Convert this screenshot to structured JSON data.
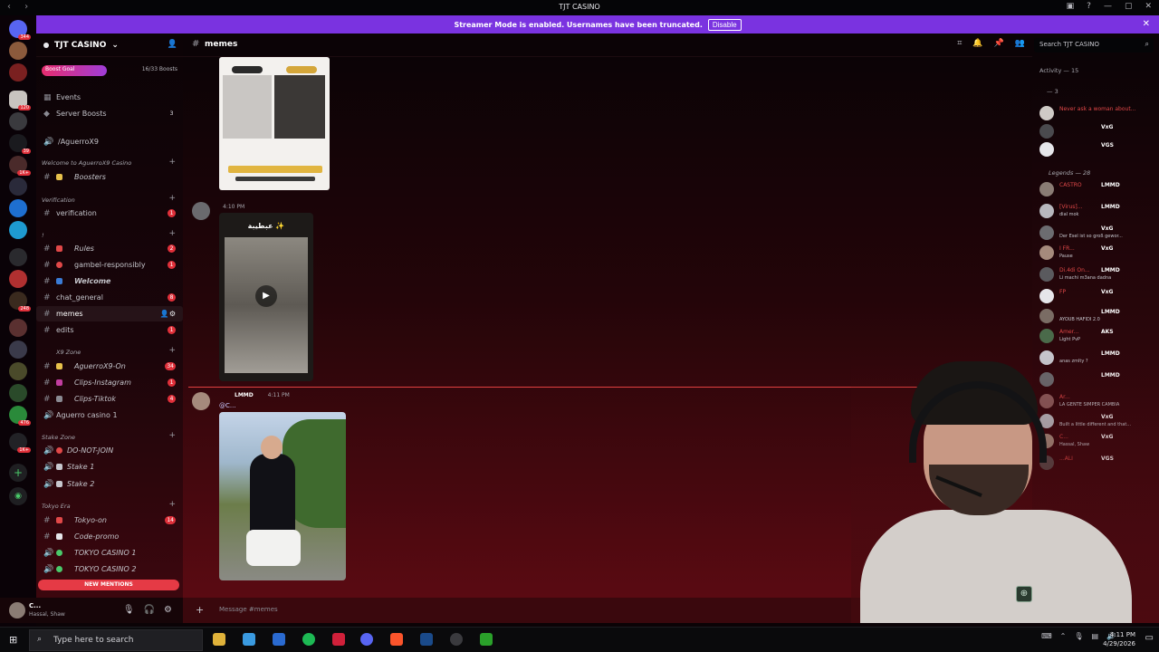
{
  "window": {
    "title": "TJT CASINO"
  },
  "banner": {
    "text": "Streamer Mode is enabled. Usernames have been truncated.",
    "button": "Disable"
  },
  "server": {
    "name": "TJT CASINO",
    "boost_goal": "Boost Goal",
    "boost_count": "16/33 Boosts",
    "boost_progress": 0.48
  },
  "guild_badges": [
    "344",
    "120",
    "39",
    "1K+",
    "248",
    "1K+",
    "476"
  ],
  "channels": [
    {
      "name": "Events",
      "kind": "events"
    },
    {
      "name": "Server Boosts",
      "kind": "boosts",
      "count": "3"
    },
    {
      "name": "/AguerroX9",
      "kind": "voice"
    },
    {
      "name": "Welcome to AguerroX9 Casino",
      "kind": "category"
    },
    {
      "name": "Boosters",
      "kind": "text",
      "emoji_color": "#e7c14b"
    },
    {
      "name": "Verification",
      "kind": "category"
    },
    {
      "name": "verification",
      "kind": "text",
      "count": "1"
    },
    {
      "name": "!",
      "kind": "category"
    },
    {
      "name": "Rules",
      "kind": "text",
      "count": "2",
      "emoji_color": "#e04848"
    },
    {
      "name": "gambel-responsibly",
      "kind": "text",
      "count": "1",
      "emoji_color": "#e04848"
    },
    {
      "name": "Welcome",
      "kind": "text",
      "emoji_color": "#3a7bd5"
    },
    {
      "name": "chat_general",
      "kind": "text",
      "count": "8"
    },
    {
      "name": "memes",
      "kind": "text",
      "active": true
    },
    {
      "name": "edits",
      "kind": "text",
      "count": "1"
    },
    {
      "name": "X9 Zone",
      "kind": "category"
    },
    {
      "name": "AguerroX9-On",
      "kind": "text",
      "count": "34",
      "emoji_color": "#e7c14b"
    },
    {
      "name": "Clips-Instagram",
      "kind": "text",
      "count": "1",
      "emoji_color": "#c23ea0"
    },
    {
      "name": "Clips-Tiktok",
      "kind": "text",
      "count": "4",
      "emoji_color": "#8a8a92"
    },
    {
      "name": "Aguerro casino 1",
      "kind": "voice"
    },
    {
      "name": "Stake Zone",
      "kind": "category"
    },
    {
      "name": "DO-NOT-JOIN",
      "kind": "text",
      "emoji_color": "#e04848"
    },
    {
      "name": "Stake 1",
      "kind": "text",
      "emoji_color": "#c7c7ce"
    },
    {
      "name": "Stake 2",
      "kind": "text",
      "emoji_color": "#c7c7ce"
    },
    {
      "name": "Tokyo Era",
      "kind": "category"
    },
    {
      "name": "Tokyo-on",
      "kind": "text",
      "count": "14",
      "emoji_color": "#e04848"
    },
    {
      "name": "Code-promo",
      "kind": "text",
      "emoji_color": "#e6e6ea"
    },
    {
      "name": "TOKYO CASINO 1",
      "kind": "voice",
      "emoji_color": "#4ac96a"
    },
    {
      "name": "TOKYO CASINO 2",
      "kind": "voice",
      "emoji_color": "#4ac96a"
    }
  ],
  "new_mentions": "NEW MENTIONS",
  "user_panel": {
    "name": "C...",
    "status": "Hassal, Shaw"
  },
  "chat_header": {
    "channel": "memes"
  },
  "search": {
    "placeholder": "Search TJT CASINO"
  },
  "messages": [
    {
      "time": "4:10 PM",
      "video_title": "عبطيبة ✨"
    },
    {
      "author_tag": "LMMD",
      "time": "4:11 PM",
      "mention": "@C..."
    }
  ],
  "composer": {
    "placeholder": "Message #memes"
  },
  "members": {
    "activity_header": "Activity — 15",
    "group_count": "— 3",
    "legends_header": "Legends — 28",
    "list": [
      {
        "name": "Never ask a woman about...",
        "tag": "",
        "status": "",
        "color": "#e04848"
      },
      {
        "name": "",
        "tag": "VxG",
        "status": "",
        "color": "#ffffff"
      },
      {
        "name": "",
        "tag": "VGS",
        "status": "",
        "color": "#ffffff"
      },
      {
        "name": "CASTRO",
        "tag": "LMMD",
        "status": "",
        "color": "#e04848"
      },
      {
        "name": "[Virus]...",
        "tag": "LMMD",
        "status": "dial mok",
        "color": "#e04848"
      },
      {
        "name": "",
        "tag": "VxG",
        "status": "Der Esel ist so groß gewor...",
        "color": "#ffffff"
      },
      {
        "name": "I FR...",
        "tag": "VxG",
        "status": "Pause",
        "color": "#e04848"
      },
      {
        "name": "Di.4di On...",
        "tag": "LMMD",
        "status": "Li machi m3ana dadna",
        "color": "#e04848"
      },
      {
        "name": "FP",
        "tag": "VxG",
        "status": "",
        "color": "#e04848"
      },
      {
        "name": "",
        "tag": "LMMD",
        "status": "AYOUB HAFIDI 2.0",
        "color": "#ffffff"
      },
      {
        "name": "Amer...",
        "tag": "AKS",
        "status": "Light PvP",
        "color": "#e04848"
      },
      {
        "name": "",
        "tag": "LMMD",
        "status": "anas zmlty ?",
        "color": "#ffffff"
      },
      {
        "name": "",
        "tag": "LMMD",
        "status": "",
        "color": "#ffffff"
      },
      {
        "name": "Ar...",
        "tag": "",
        "status": "LA GENTE SIMPER CAMBIA",
        "color": "#e04848"
      },
      {
        "name": "",
        "tag": "VxG",
        "status": "Built a little different and that...",
        "color": "#ffffff"
      },
      {
        "name": "C...",
        "tag": "VxG",
        "status": "Hassal, Shaw",
        "color": "#e04848"
      },
      {
        "name": "...ALI",
        "tag": "VGS",
        "status": "",
        "color": "#e04848"
      }
    ]
  },
  "taskbar": {
    "search_placeholder": "Type here to search",
    "time": "4:11 PM",
    "date": "4/29/2026"
  }
}
